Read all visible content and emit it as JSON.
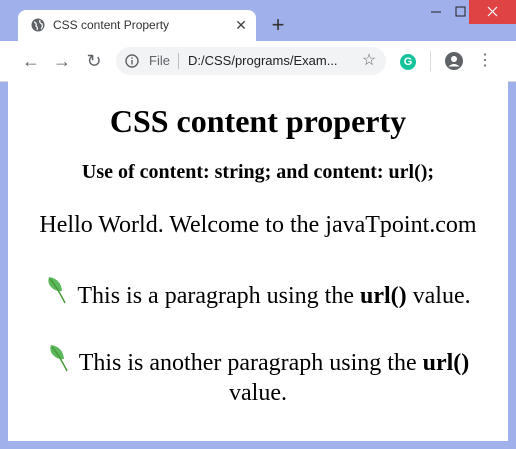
{
  "browser": {
    "tab_title": "CSS content Property",
    "new_tab_symbol": "+",
    "file_label": "File",
    "url": "D:/CSS/programs/Exam...",
    "icons": {
      "favicon": "globe-icon",
      "close": "close-icon",
      "back": "back-arrow-icon",
      "forward": "forward-arrow-icon",
      "reload": "reload-icon",
      "info": "info-icon",
      "star": "star-icon",
      "grammarly": "grammarly-icon",
      "profile": "profile-icon",
      "menu": "kebab-menu-icon"
    }
  },
  "page": {
    "heading": "CSS content property",
    "subheading": "Use of content: string; and content: url();",
    "hello_text": "Hello World. Welcome to the javaTpoint.com",
    "para1_pre": "This is a paragraph using the ",
    "para1_bold": "url()",
    "para1_post": " value.",
    "para2_pre": "This is another paragraph using the ",
    "para2_bold": "url()",
    "para2_post": " value."
  },
  "colors": {
    "frame": "#9fb0ea",
    "close_button": "#e04343",
    "leaf": "#5cb85c"
  }
}
